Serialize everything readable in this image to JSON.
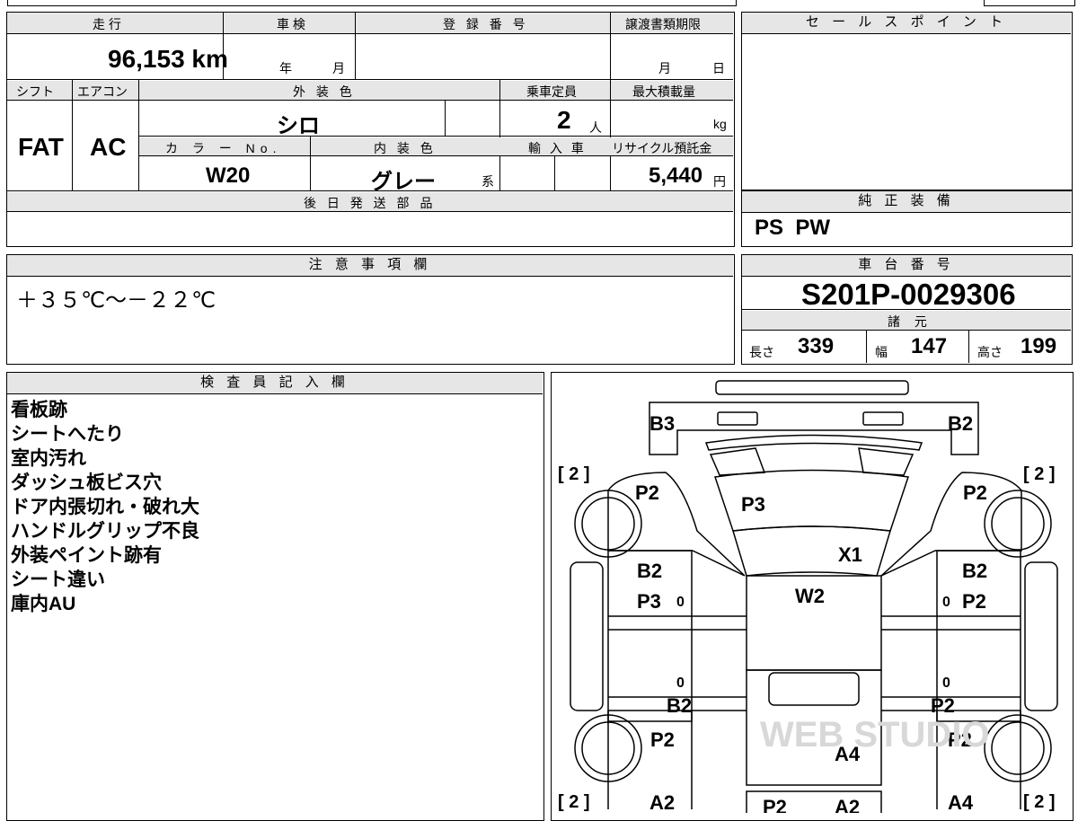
{
  "top_box": {
    "mileage_label": "走 行",
    "inspection_label": "車 検",
    "registration_label": "登 録 番 号",
    "transfer_deadline_label": "譲渡書類期限",
    "mileage_value": "96,153 km",
    "inspection_year_unit": "年",
    "inspection_month_unit": "月",
    "deadline_month_unit": "月",
    "deadline_day_unit": "日",
    "shift_label": "シフト",
    "aircon_label": "エアコン",
    "exterior_color_label": "外 装 色",
    "capacity_label": "乗車定員",
    "max_load_label": "最大積載量",
    "shift_value": "FAT",
    "aircon_value": "AC",
    "exterior_color_value": "シロ",
    "capacity_value": "2",
    "capacity_unit": "人",
    "max_load_unit": "kg",
    "color_no_label": "カ ラ ー No.",
    "interior_color_label": "内 装 色",
    "import_label": "輸 入 車",
    "recycle_label": "リサイクル預託金",
    "color_no_value": "W20",
    "interior_color_value": "グレー",
    "interior_color_suffix": "系",
    "recycle_value": "5,440",
    "recycle_unit": "円",
    "later_parts_label": "後 日 発 送 部 品"
  },
  "sales_point": {
    "label": "セ ー ル ス ポ イ ン ト"
  },
  "genuine_equipment": {
    "label": "純 正 装 備",
    "value": "PS  PW"
  },
  "notes": {
    "label": "注 意 事 項 欄",
    "value": "＋３５℃～－２２℃"
  },
  "chassis": {
    "label": "車 台 番 号",
    "value": "S201P-0029306",
    "specs_label": "諸 元",
    "length_label": "長さ",
    "length_value": "339",
    "width_label": "幅",
    "width_value": "147",
    "height_label": "高さ",
    "height_value": "199"
  },
  "inspector": {
    "label": "検 査 員 記 入 欄",
    "lines": [
      "看板跡",
      "シートへたり",
      "室内汚れ",
      "ダッシュ板ビス穴",
      "ドア内張切れ・破れ大",
      "ハンドルグリップ不良",
      "外装ペイント跡有",
      "シート違い",
      "庫内AU"
    ]
  },
  "diagram": {
    "watermark": "WEB STUDIO",
    "marks": {
      "b3": "B3",
      "b2_top": "B2",
      "p2_front_left": "P2",
      "p3_hood": "P3",
      "p2_front_right": "P2",
      "x1": "X1",
      "b2_left": "B2",
      "p3_left": "P3",
      "w2": "W2",
      "b2_right": "B2",
      "p2_right": "P2",
      "b2_lower_left": "B2",
      "p2_lower_right": "P2",
      "p2_rear_left": "P2",
      "a4_center": "A4",
      "p2_rear_right": "P2",
      "a2_left": "A2",
      "p2_bottom": "P2",
      "a2_bottom": "A2",
      "a4_right": "A4",
      "tire_tl": "[ 2 ]",
      "tire_tr": "[ 2 ]",
      "tire_bl": "[ 2 ]",
      "tire_br": "[ 2 ]",
      "zero_l1": "0",
      "zero_r1": "0",
      "zero_l2": "0",
      "zero_r2": "0"
    }
  }
}
